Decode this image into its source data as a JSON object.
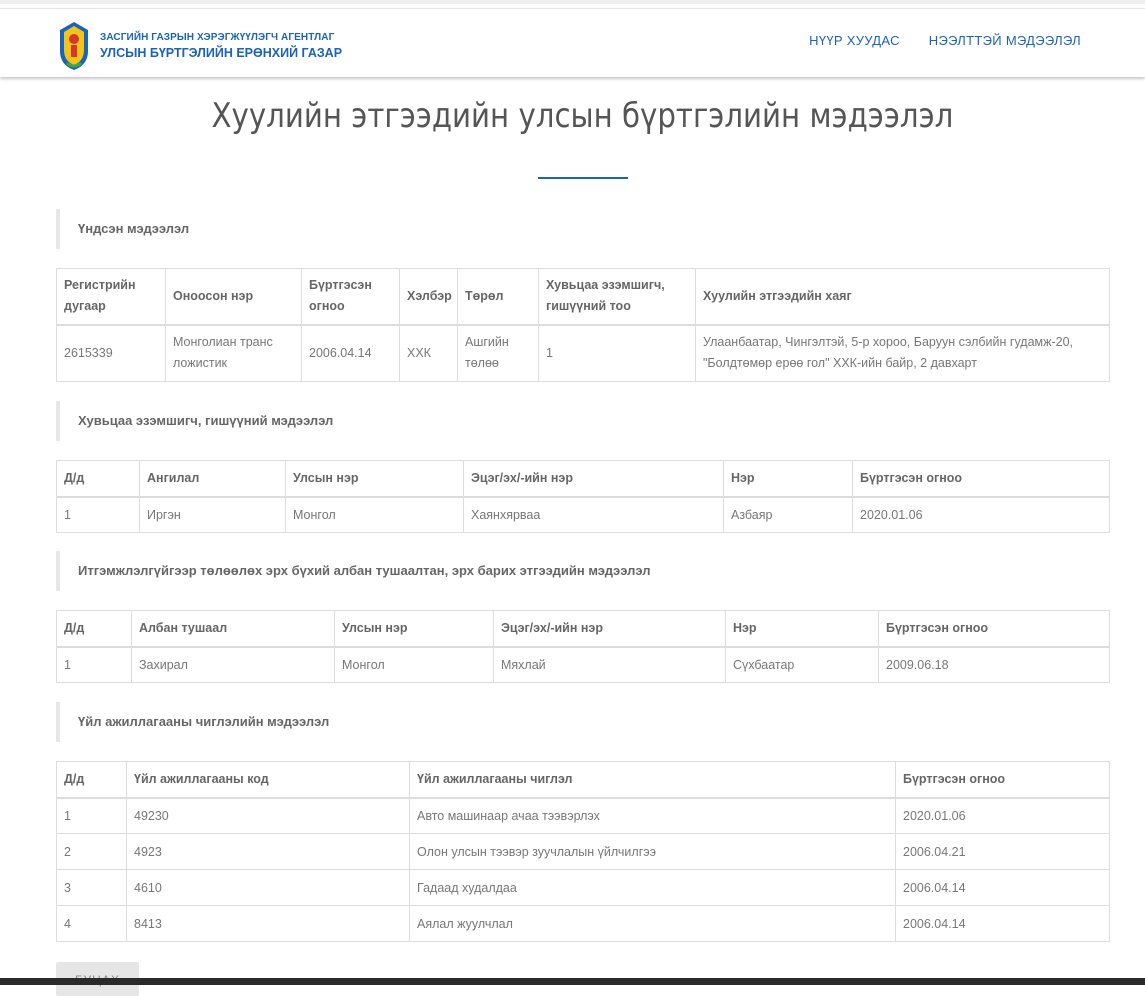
{
  "header": {
    "agency_line1": "ЗАСГИЙН ГАЗРЫН ХЭРЭГЖҮҮЛЭГЧ АГЕНТЛАГ",
    "agency_line2": "УЛСЫН БҮРТГЭЛИЙН ЕРӨНХИЙ ГАЗАР",
    "nav": [
      "НҮҮР ХУУДАС",
      "НЭЭЛТТЭЙ МЭДЭЭЛЭЛ"
    ]
  },
  "page_title": "Хуулийн этгээдийн улсын бүртгэлийн мэдээлэл",
  "basic": {
    "heading": "Үндсэн мэдээлэл",
    "columns": [
      "Регистрийн дугаар",
      "Оноосон нэр",
      "Бүртгэсэн огноо",
      "Хэлбэр",
      "Төрөл",
      "Хувьцаа эзэмшигч, гишүүний тоо",
      "Хуулийн этгээдийн хаяг"
    ],
    "rows": [
      [
        "2615339",
        "Монголиан транс ложистик",
        "2006.04.14",
        "ХХК",
        "Ашгийн төлөө",
        "1",
        "Улаанбаатар, Чингэлтэй, 5-р хороо, Баруун сэлбийн гудамж-20, \"Болдтөмөр ерөө гол\" ХХК-ийн байр, 2 давхарт"
      ]
    ]
  },
  "shareholders": {
    "heading": "Хувьцаа эзэмшигч, гишүүний мэдээлэл",
    "columns": [
      "Д/д",
      "Ангилал",
      "Улсын нэр",
      "Эцэг/эх/-ийн нэр",
      "Нэр",
      "Бүртгэсэн огноо"
    ],
    "rows": [
      [
        "1",
        "Иргэн",
        "Монгол",
        "Хаянхярваа",
        "Азбаяр",
        "2020.01.06"
      ]
    ]
  },
  "officials": {
    "heading": "Итгэмжлэлгүйгээр төлөөлөх эрх бүхий албан тушаалтан, эрх барих этгээдийн мэдээлэл",
    "columns": [
      "Д/д",
      "Албан тушаал",
      "Улсын нэр",
      "Эцэг/эх/-ийн нэр",
      "Нэр",
      "Бүртгэсэн огноо"
    ],
    "rows": [
      [
        "1",
        "Захирал",
        "Монгол",
        "Мяхлай",
        "Сүхбаатар",
        "2009.06.18"
      ]
    ]
  },
  "activities": {
    "heading": "Үйл ажиллагааны чиглэлийн мэдээлэл",
    "columns": [
      "Д/д",
      "Үйл ажиллагааны код",
      "Үйл ажиллагааны чиглэл",
      "Бүртгэсэн огноо"
    ],
    "rows": [
      [
        "1",
        "49230",
        "Авто машинаар ачаа тээвэрлэх",
        "2020.01.06"
      ],
      [
        "2",
        "4923",
        "Олон улсын тээвэр зуучлалын үйлчилгээ",
        "2006.04.21"
      ],
      [
        "3",
        "4610",
        "Гадаад худалдаа",
        "2006.04.14"
      ],
      [
        "4",
        "8413",
        "Аялал жуулчлал",
        "2006.04.14"
      ]
    ]
  },
  "back_button": "БУЦАХ"
}
